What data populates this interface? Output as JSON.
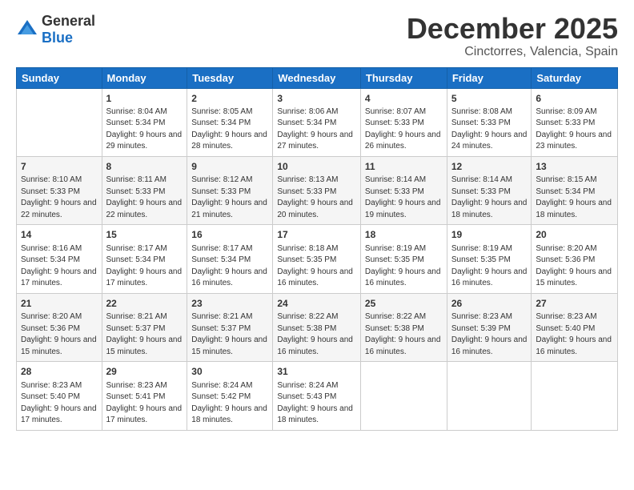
{
  "logo": {
    "general": "General",
    "blue": "Blue"
  },
  "header": {
    "month": "December 2025",
    "location": "Cinctorres, Valencia, Spain"
  },
  "weekdays": [
    "Sunday",
    "Monday",
    "Tuesday",
    "Wednesday",
    "Thursday",
    "Friday",
    "Saturday"
  ],
  "weeks": [
    [
      {
        "day": "",
        "sunrise": "",
        "sunset": "",
        "daylight": ""
      },
      {
        "day": "1",
        "sunrise": "Sunrise: 8:04 AM",
        "sunset": "Sunset: 5:34 PM",
        "daylight": "Daylight: 9 hours and 29 minutes."
      },
      {
        "day": "2",
        "sunrise": "Sunrise: 8:05 AM",
        "sunset": "Sunset: 5:34 PM",
        "daylight": "Daylight: 9 hours and 28 minutes."
      },
      {
        "day": "3",
        "sunrise": "Sunrise: 8:06 AM",
        "sunset": "Sunset: 5:34 PM",
        "daylight": "Daylight: 9 hours and 27 minutes."
      },
      {
        "day": "4",
        "sunrise": "Sunrise: 8:07 AM",
        "sunset": "Sunset: 5:33 PM",
        "daylight": "Daylight: 9 hours and 26 minutes."
      },
      {
        "day": "5",
        "sunrise": "Sunrise: 8:08 AM",
        "sunset": "Sunset: 5:33 PM",
        "daylight": "Daylight: 9 hours and 24 minutes."
      },
      {
        "day": "6",
        "sunrise": "Sunrise: 8:09 AM",
        "sunset": "Sunset: 5:33 PM",
        "daylight": "Daylight: 9 hours and 23 minutes."
      }
    ],
    [
      {
        "day": "7",
        "sunrise": "Sunrise: 8:10 AM",
        "sunset": "Sunset: 5:33 PM",
        "daylight": "Daylight: 9 hours and 22 minutes."
      },
      {
        "day": "8",
        "sunrise": "Sunrise: 8:11 AM",
        "sunset": "Sunset: 5:33 PM",
        "daylight": "Daylight: 9 hours and 22 minutes."
      },
      {
        "day": "9",
        "sunrise": "Sunrise: 8:12 AM",
        "sunset": "Sunset: 5:33 PM",
        "daylight": "Daylight: 9 hours and 21 minutes."
      },
      {
        "day": "10",
        "sunrise": "Sunrise: 8:13 AM",
        "sunset": "Sunset: 5:33 PM",
        "daylight": "Daylight: 9 hours and 20 minutes."
      },
      {
        "day": "11",
        "sunrise": "Sunrise: 8:14 AM",
        "sunset": "Sunset: 5:33 PM",
        "daylight": "Daylight: 9 hours and 19 minutes."
      },
      {
        "day": "12",
        "sunrise": "Sunrise: 8:14 AM",
        "sunset": "Sunset: 5:33 PM",
        "daylight": "Daylight: 9 hours and 18 minutes."
      },
      {
        "day": "13",
        "sunrise": "Sunrise: 8:15 AM",
        "sunset": "Sunset: 5:34 PM",
        "daylight": "Daylight: 9 hours and 18 minutes."
      }
    ],
    [
      {
        "day": "14",
        "sunrise": "Sunrise: 8:16 AM",
        "sunset": "Sunset: 5:34 PM",
        "daylight": "Daylight: 9 hours and 17 minutes."
      },
      {
        "day": "15",
        "sunrise": "Sunrise: 8:17 AM",
        "sunset": "Sunset: 5:34 PM",
        "daylight": "Daylight: 9 hours and 17 minutes."
      },
      {
        "day": "16",
        "sunrise": "Sunrise: 8:17 AM",
        "sunset": "Sunset: 5:34 PM",
        "daylight": "Daylight: 9 hours and 16 minutes."
      },
      {
        "day": "17",
        "sunrise": "Sunrise: 8:18 AM",
        "sunset": "Sunset: 5:35 PM",
        "daylight": "Daylight: 9 hours and 16 minutes."
      },
      {
        "day": "18",
        "sunrise": "Sunrise: 8:19 AM",
        "sunset": "Sunset: 5:35 PM",
        "daylight": "Daylight: 9 hours and 16 minutes."
      },
      {
        "day": "19",
        "sunrise": "Sunrise: 8:19 AM",
        "sunset": "Sunset: 5:35 PM",
        "daylight": "Daylight: 9 hours and 16 minutes."
      },
      {
        "day": "20",
        "sunrise": "Sunrise: 8:20 AM",
        "sunset": "Sunset: 5:36 PM",
        "daylight": "Daylight: 9 hours and 15 minutes."
      }
    ],
    [
      {
        "day": "21",
        "sunrise": "Sunrise: 8:20 AM",
        "sunset": "Sunset: 5:36 PM",
        "daylight": "Daylight: 9 hours and 15 minutes."
      },
      {
        "day": "22",
        "sunrise": "Sunrise: 8:21 AM",
        "sunset": "Sunset: 5:37 PM",
        "daylight": "Daylight: 9 hours and 15 minutes."
      },
      {
        "day": "23",
        "sunrise": "Sunrise: 8:21 AM",
        "sunset": "Sunset: 5:37 PM",
        "daylight": "Daylight: 9 hours and 15 minutes."
      },
      {
        "day": "24",
        "sunrise": "Sunrise: 8:22 AM",
        "sunset": "Sunset: 5:38 PM",
        "daylight": "Daylight: 9 hours and 16 minutes."
      },
      {
        "day": "25",
        "sunrise": "Sunrise: 8:22 AM",
        "sunset": "Sunset: 5:38 PM",
        "daylight": "Daylight: 9 hours and 16 minutes."
      },
      {
        "day": "26",
        "sunrise": "Sunrise: 8:23 AM",
        "sunset": "Sunset: 5:39 PM",
        "daylight": "Daylight: 9 hours and 16 minutes."
      },
      {
        "day": "27",
        "sunrise": "Sunrise: 8:23 AM",
        "sunset": "Sunset: 5:40 PM",
        "daylight": "Daylight: 9 hours and 16 minutes."
      }
    ],
    [
      {
        "day": "28",
        "sunrise": "Sunrise: 8:23 AM",
        "sunset": "Sunset: 5:40 PM",
        "daylight": "Daylight: 9 hours and 17 minutes."
      },
      {
        "day": "29",
        "sunrise": "Sunrise: 8:23 AM",
        "sunset": "Sunset: 5:41 PM",
        "daylight": "Daylight: 9 hours and 17 minutes."
      },
      {
        "day": "30",
        "sunrise": "Sunrise: 8:24 AM",
        "sunset": "Sunset: 5:42 PM",
        "daylight": "Daylight: 9 hours and 18 minutes."
      },
      {
        "day": "31",
        "sunrise": "Sunrise: 8:24 AM",
        "sunset": "Sunset: 5:43 PM",
        "daylight": "Daylight: 9 hours and 18 minutes."
      },
      {
        "day": "",
        "sunrise": "",
        "sunset": "",
        "daylight": ""
      },
      {
        "day": "",
        "sunrise": "",
        "sunset": "",
        "daylight": ""
      },
      {
        "day": "",
        "sunrise": "",
        "sunset": "",
        "daylight": ""
      }
    ]
  ]
}
